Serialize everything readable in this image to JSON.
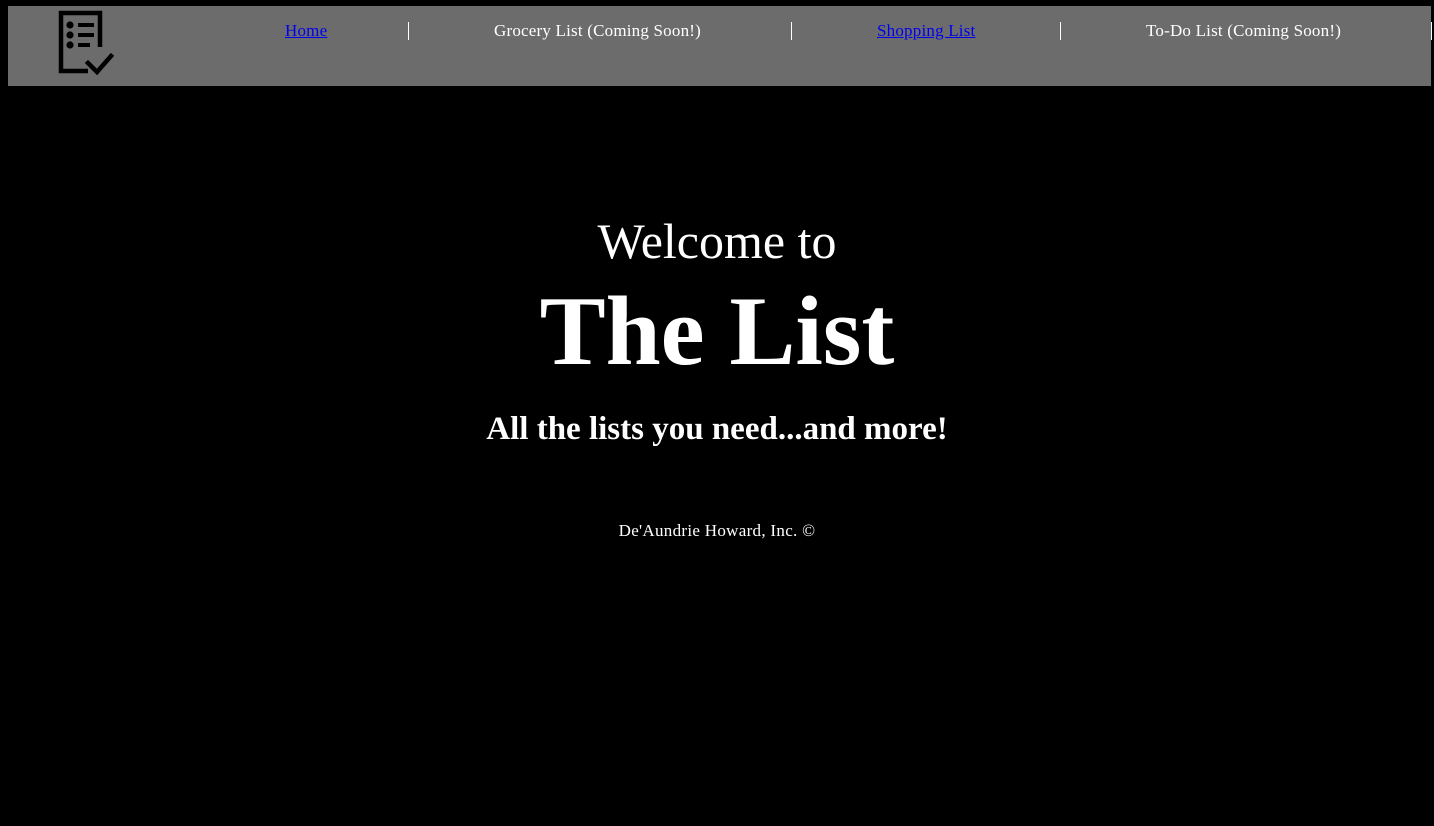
{
  "nav": {
    "logo_icon": "checklist-icon",
    "items": [
      {
        "label": "Home",
        "link": true
      },
      {
        "label": "Grocery List (Coming Soon!)",
        "link": false
      },
      {
        "label": "Shopping List",
        "link": true
      },
      {
        "label": "To-Do List (Coming Soon!)",
        "link": false
      }
    ]
  },
  "hero": {
    "welcome": "Welcome to",
    "title": "The List",
    "tagline": "All the lists you need...and more!"
  },
  "footer": {
    "text": "De'Aundrie Howard, Inc. ©"
  },
  "colors": {
    "background": "#000000",
    "navbar": "#6c6c6c",
    "link": "#0000ee",
    "text": "#ffffff"
  }
}
